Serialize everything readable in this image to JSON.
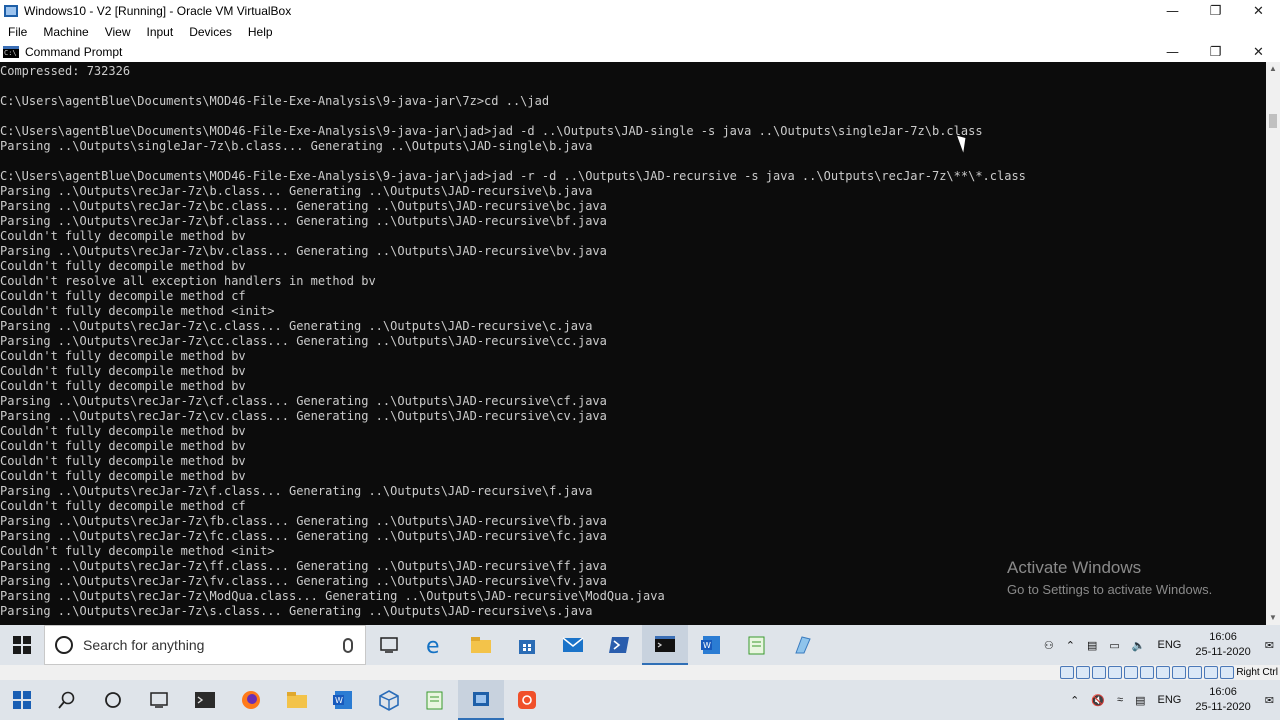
{
  "vbox": {
    "title": "Windows10 - V2 [Running] - Oracle VM VirtualBox",
    "menu": [
      "File",
      "Machine",
      "View",
      "Input",
      "Devices",
      "Help"
    ],
    "status_host_key": "Right Ctrl"
  },
  "cmd": {
    "title": "Command Prompt",
    "icon_text": "C:\\",
    "lines": [
      "Compressed: 732326",
      "",
      "C:\\Users\\agentBlue\\Documents\\MOD46-File-Exe-Analysis\\9-java-jar\\7z>cd ..\\jad",
      "",
      "C:\\Users\\agentBlue\\Documents\\MOD46-File-Exe-Analysis\\9-java-jar\\jad>jad -d ..\\Outputs\\JAD-single -s java ..\\Outputs\\singleJar-7z\\b.class",
      "Parsing ..\\Outputs\\singleJar-7z\\b.class... Generating ..\\Outputs\\JAD-single\\b.java",
      "",
      "C:\\Users\\agentBlue\\Documents\\MOD46-File-Exe-Analysis\\9-java-jar\\jad>jad -r -d ..\\Outputs\\JAD-recursive -s java ..\\Outputs\\recJar-7z\\**\\*.class",
      "Parsing ..\\Outputs\\recJar-7z\\b.class... Generating ..\\Outputs\\JAD-recursive\\b.java",
      "Parsing ..\\Outputs\\recJar-7z\\bc.class... Generating ..\\Outputs\\JAD-recursive\\bc.java",
      "Parsing ..\\Outputs\\recJar-7z\\bf.class... Generating ..\\Outputs\\JAD-recursive\\bf.java",
      "Couldn't fully decompile method bv",
      "Parsing ..\\Outputs\\recJar-7z\\bv.class... Generating ..\\Outputs\\JAD-recursive\\bv.java",
      "Couldn't fully decompile method bv",
      "Couldn't resolve all exception handlers in method bv",
      "Couldn't fully decompile method cf",
      "Couldn't fully decompile method <init>",
      "Parsing ..\\Outputs\\recJar-7z\\c.class... Generating ..\\Outputs\\JAD-recursive\\c.java",
      "Parsing ..\\Outputs\\recJar-7z\\cc.class... Generating ..\\Outputs\\JAD-recursive\\cc.java",
      "Couldn't fully decompile method bv",
      "Couldn't fully decompile method bv",
      "Couldn't fully decompile method bv",
      "Parsing ..\\Outputs\\recJar-7z\\cf.class... Generating ..\\Outputs\\JAD-recursive\\cf.java",
      "Parsing ..\\Outputs\\recJar-7z\\cv.class... Generating ..\\Outputs\\JAD-recursive\\cv.java",
      "Couldn't fully decompile method bv",
      "Couldn't fully decompile method bv",
      "Couldn't fully decompile method bv",
      "Couldn't fully decompile method bv",
      "Parsing ..\\Outputs\\recJar-7z\\f.class... Generating ..\\Outputs\\JAD-recursive\\f.java",
      "Couldn't fully decompile method cf",
      "Parsing ..\\Outputs\\recJar-7z\\fb.class... Generating ..\\Outputs\\JAD-recursive\\fb.java",
      "Parsing ..\\Outputs\\recJar-7z\\fc.class... Generating ..\\Outputs\\JAD-recursive\\fc.java",
      "Couldn't fully decompile method <init>",
      "Parsing ..\\Outputs\\recJar-7z\\ff.class... Generating ..\\Outputs\\JAD-recursive\\ff.java",
      "Parsing ..\\Outputs\\recJar-7z\\fv.class... Generating ..\\Outputs\\JAD-recursive\\fv.java",
      "Parsing ..\\Outputs\\recJar-7z\\ModQua.class... Generating ..\\Outputs\\JAD-recursive\\ModQua.java",
      "Parsing ..\\Outputs\\recJar-7z\\s.class... Generating ..\\Outputs\\JAD-recursive\\s.java"
    ]
  },
  "watermark": {
    "line1": "Activate Windows",
    "line2": "Go to Settings to activate Windows."
  },
  "guest_taskbar": {
    "search_placeholder": "Search for anything",
    "lang": "ENG",
    "time": "16:06",
    "date": "25-11-2020"
  },
  "host_taskbar": {
    "lang": "ENG",
    "time": "16:06",
    "date": "25-11-2020"
  },
  "colors": {
    "console_bg": "#0c0c0c",
    "console_fg": "#cccccc",
    "taskbar_bg": "#dfe4ea"
  }
}
